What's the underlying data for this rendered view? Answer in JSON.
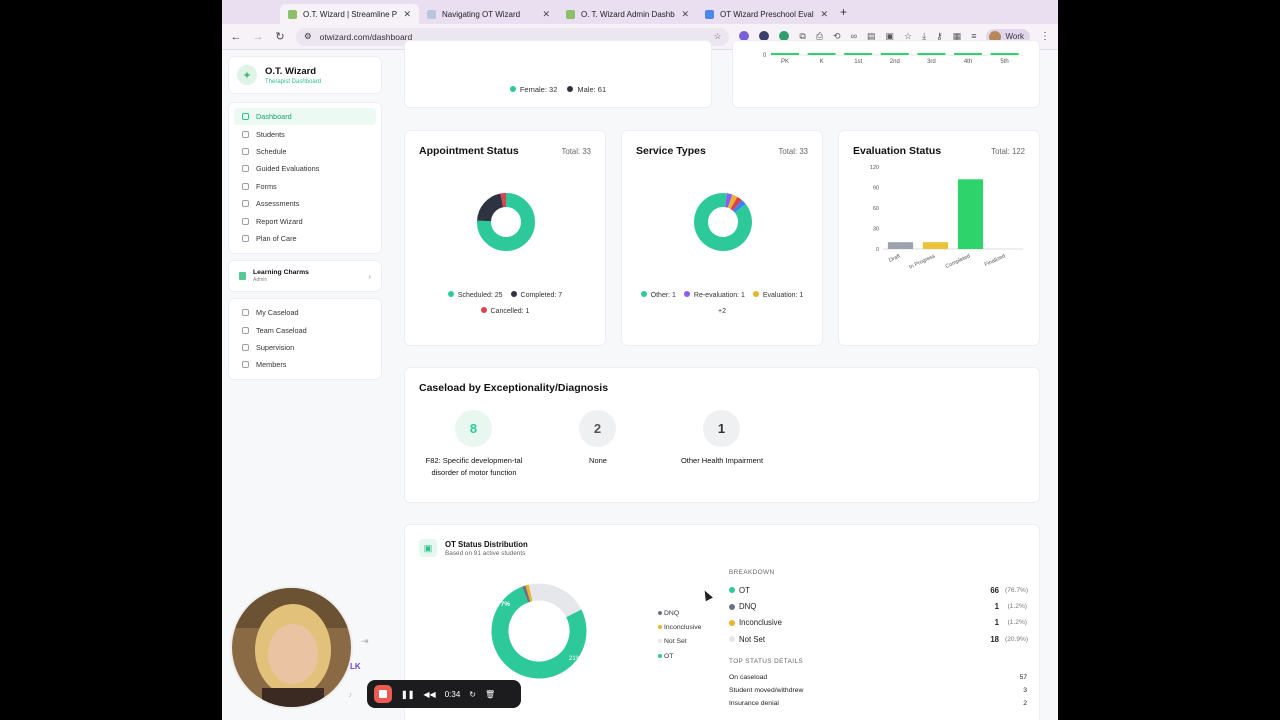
{
  "browser": {
    "tabs": [
      {
        "label": "O.T. Wizard | Streamline Pedi",
        "active": true
      },
      {
        "label": "Navigating OT Wizard",
        "active": false
      },
      {
        "label": "O. T. Wizard Admin Dashboa",
        "active": false
      },
      {
        "label": "OT Wizard Preschool Evaluati",
        "active": false
      }
    ],
    "url": "otwizard.com/dashboard",
    "profile": "Work"
  },
  "sidebar": {
    "brand_title": "O.T. Wizard",
    "brand_subtitle": "Therapist Dashboard",
    "nav": [
      "Dashboard",
      "Students",
      "Schedule",
      "Guided Evaluations",
      "Forms",
      "Assessments",
      "Report Wizard",
      "Plan of Care"
    ],
    "org_name": "Learning Charms",
    "org_role": "Admin",
    "nav2": [
      "My Caseload",
      "Team Caseload",
      "Supervision",
      "Members"
    ]
  },
  "gender_legend": {
    "female": "Female: 32",
    "male": "Male: 61"
  },
  "grade_ticks": [
    "PK",
    "K",
    "1st",
    "2nd",
    "3rd",
    "4th",
    "5th"
  ],
  "grade_zero": "0",
  "appointment": {
    "title": "Appointment Status",
    "total": "Total: 33",
    "legend": [
      "Scheduled: 25",
      "Completed: 7",
      "Cancelled: 1"
    ],
    "colors": [
      "#2ec99a",
      "#2d3340",
      "#d9424f"
    ],
    "values": [
      25,
      7,
      1
    ]
  },
  "service": {
    "title": "Service Types",
    "total": "Total: 33",
    "legend": [
      "Other: 1",
      "Re-evaluation: 1",
      "Evaluation: 1"
    ],
    "more": "+2",
    "colors": [
      "#2ec99a",
      "#8a5cf6",
      "#e9b42c"
    ]
  },
  "evaluation": {
    "title": "Evaluation Status",
    "total": "Total: 122",
    "chart_data": {
      "type": "bar",
      "categories": [
        "Draft",
        "In Progress",
        "Completed",
        "Finalized"
      ],
      "values": [
        10,
        10,
        102,
        0
      ],
      "colors": [
        "#9ca3af",
        "#e9c43a",
        "#2fd36b",
        "#2fd36b"
      ],
      "ylim": [
        0,
        120
      ],
      "yticks": [
        "0",
        "30",
        "60",
        "90",
        "120"
      ],
      "grid": false
    }
  },
  "caseload": {
    "title": "Caseload by Exceptionality/Diagnosis",
    "items": [
      {
        "count": "8",
        "label": "F82: Specific developmen-tal disorder of motor function"
      },
      {
        "count": "2",
        "label": "None"
      },
      {
        "count": "1",
        "label": "Other Health Impairment"
      }
    ]
  },
  "ot_status": {
    "title": "OT Status Distribution",
    "subtitle": "Based on 91 active students",
    "pct_main": "77%",
    "pct_minor": "21%",
    "mini_legend": [
      "DNQ",
      "Inconclusive",
      "Not Set",
      "OT"
    ],
    "breakdown_heading": "BREAKDOWN",
    "breakdown": [
      {
        "label": "OT",
        "value": "66",
        "pct": "(76.7%)",
        "color": "#2ec99a"
      },
      {
        "label": "DNQ",
        "value": "1",
        "pct": "(1.2%)",
        "color": "#6b7280"
      },
      {
        "label": "Inconclusive",
        "value": "1",
        "pct": "(1.2%)",
        "color": "#e9b42c"
      },
      {
        "label": "Not Set",
        "value": "18",
        "pct": "(20.9%)",
        "color": "#e5e7eb"
      }
    ],
    "details_heading": "TOP STATUS DETAILS",
    "details": [
      {
        "label": "On caseload",
        "value": "57"
      },
      {
        "label": "Student moved/withdrew",
        "value": "3"
      },
      {
        "label": "Insurance denial",
        "value": "2"
      }
    ]
  },
  "recorder": {
    "time": "0:34"
  },
  "webcam_badge": "LK"
}
